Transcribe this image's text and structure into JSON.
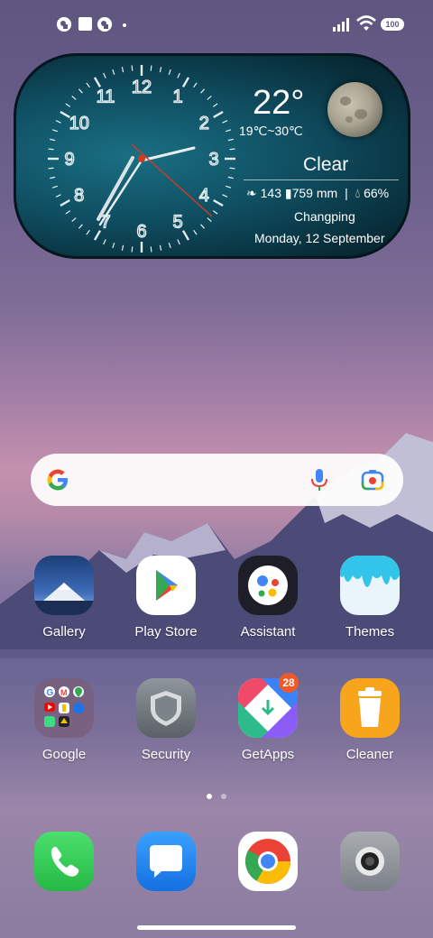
{
  "status_bar": {
    "battery": "100",
    "left_icons": [
      "app-notification-icon",
      "square-notification-icon",
      "app-notification-icon",
      "dot-icon"
    ],
    "right_icons": [
      "signal-icon",
      "wifi-icon",
      "battery-icon"
    ]
  },
  "widget": {
    "clock_numbers": [
      "12",
      "1",
      "2",
      "3",
      "4",
      "5",
      "6",
      "7",
      "8",
      "9",
      "10",
      "11"
    ],
    "temperature": "22°",
    "range": "19℃~30℃",
    "condition": "Clear",
    "air_quality": "143",
    "rain": "759 mm",
    "humidity": "66%",
    "city": "Changping",
    "date": "Monday, 12 September"
  },
  "search": {
    "icons": [
      "google-g-icon",
      "microphone-icon",
      "lens-camera-icon"
    ]
  },
  "apps_row1": [
    {
      "label": "Gallery"
    },
    {
      "label": "Play Store"
    },
    {
      "label": "Assistant"
    },
    {
      "label": "Themes"
    }
  ],
  "apps_row2": [
    {
      "label": "Google"
    },
    {
      "label": "Security"
    },
    {
      "label": "GetApps",
      "badge": "28"
    },
    {
      "label": "Cleaner"
    }
  ],
  "dock": [
    "phone-icon",
    "messages-icon",
    "chrome-icon",
    "camera-icon"
  ],
  "colors": {
    "badge": "#f05a28",
    "phone_green": "#2ecc52",
    "messages_blue": "#1b83f0",
    "cleaner_orange": "#f7a51d"
  }
}
